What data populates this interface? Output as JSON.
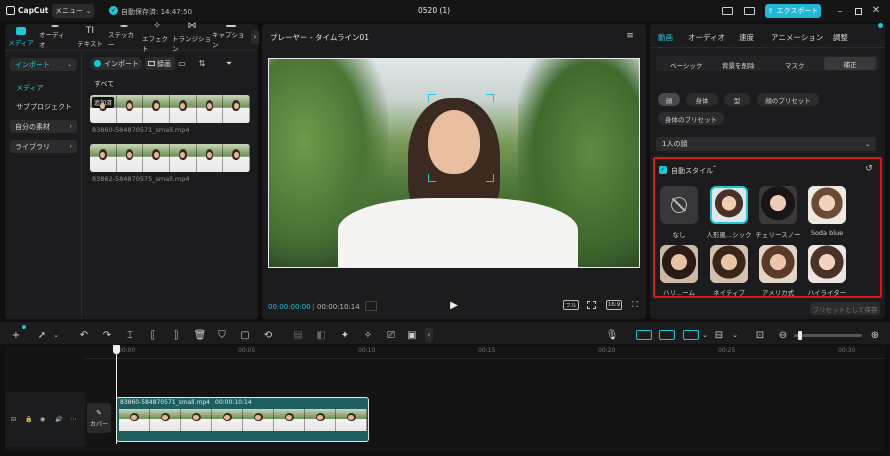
{
  "titlebar": {
    "app_name": "CapCut",
    "menu_label": "メニュー",
    "autosave_text": "自動保存済: 14:47:50",
    "project_title": "0520 (1)",
    "export_label": "エクスポート"
  },
  "media_tabs": [
    {
      "label": "メディア",
      "icon": "media-icon"
    },
    {
      "label": "オーディオ",
      "icon": "audio-icon"
    },
    {
      "label": "テキスト",
      "icon": "text-icon"
    },
    {
      "label": "ステッカー",
      "icon": "sticker-icon"
    },
    {
      "label": "エフェクト",
      "icon": "effect-icon"
    },
    {
      "label": "トランジション",
      "icon": "transition-icon"
    },
    {
      "label": "キャプション",
      "icon": "caption-icon"
    }
  ],
  "sidebar": {
    "import_label": "インポート",
    "media_label": "メディア",
    "subproject_label": "サブプロジェクト",
    "my_assets_label": "自分の素材",
    "library_label": "ライブラリ"
  },
  "media_panel": {
    "import_button": "インポート",
    "record_label": "録画",
    "all_label": "すべて",
    "added_badge": "追加済",
    "clips": [
      {
        "filename": "83860-584870571_small.mp4"
      },
      {
        "filename": "83862-584870575_small.mp4"
      }
    ]
  },
  "player": {
    "title": "プレーヤー - タイムライン01",
    "current_time": "00:00:00:00",
    "total_time": "00:00:10:14",
    "full_label": "フル",
    "ratio_label": "16:9"
  },
  "inspector": {
    "tabs": [
      "動画",
      "オーディオ",
      "速度",
      "アニメーション",
      "調整"
    ],
    "subtabs": [
      "ベーシック",
      "背景を削除",
      "マスク",
      "補正"
    ],
    "chips": [
      "顔",
      "身体",
      "型",
      "顔のプリセット",
      "身体のプリセット"
    ],
    "face_select": "1人の顔",
    "auto_style_label": "自動スタイル",
    "styles": [
      {
        "label": "なし"
      },
      {
        "label": "人形風...シック"
      },
      {
        "label": "チェリースノー"
      },
      {
        "label": "Soda blue"
      },
      {
        "label": "ハリ...ーム"
      },
      {
        "label": "ネイティブ"
      },
      {
        "label": "アメリカ式"
      },
      {
        "label": "ハイライター"
      }
    ],
    "save_preset_label": "プリセットとして保存"
  },
  "timeline": {
    "ticks": [
      "00:00",
      "00:05",
      "00:10",
      "00:15",
      "00:20",
      "00:25",
      "00:30"
    ],
    "cover_label": "カバー",
    "clip_name": "83860-584870571_small.mp4",
    "clip_duration": "00:00:10:14"
  },
  "colors": {
    "accent": "#1fc7d4",
    "highlight": "#e0151b",
    "export": "#1fb8d6"
  }
}
